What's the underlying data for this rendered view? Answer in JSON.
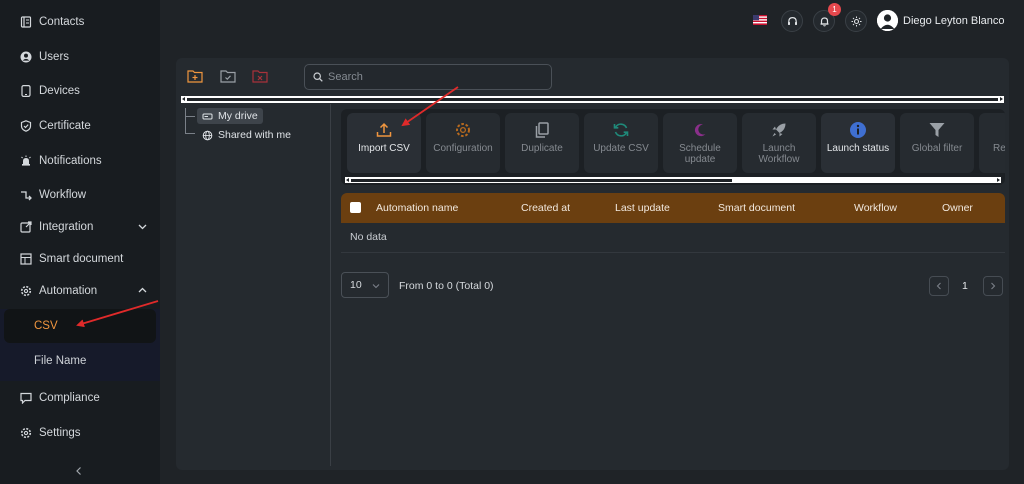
{
  "sidebar": {
    "items": [
      {
        "label": "Contacts",
        "icon": "contacts-icon"
      },
      {
        "label": "Users",
        "icon": "user-icon"
      },
      {
        "label": "Devices",
        "icon": "device-icon"
      },
      {
        "label": "Certificate",
        "icon": "shield-check-icon"
      },
      {
        "label": "Notifications",
        "icon": "alarm-icon"
      },
      {
        "label": "Workflow",
        "icon": "workflow-icon"
      },
      {
        "label": "Integration",
        "icon": "external-link-icon"
      },
      {
        "label": "Smart document",
        "icon": "table-icon"
      },
      {
        "label": "Automation",
        "icon": "gear-icon"
      },
      {
        "label": "Compliance",
        "icon": "chat-icon"
      },
      {
        "label": "Settings",
        "icon": "settings-icon"
      }
    ],
    "automation_children": [
      {
        "label": "CSV",
        "active": true
      },
      {
        "label": "File Name",
        "active": false
      }
    ]
  },
  "header": {
    "notification_count": "1",
    "user_name": "Diego Leyton Blanco"
  },
  "search": {
    "placeholder": "Search"
  },
  "tree": {
    "nodes": [
      {
        "label": "My drive",
        "selected": true
      },
      {
        "label": "Shared with me",
        "selected": false
      }
    ]
  },
  "actions": [
    {
      "label": "Import CSV",
      "icon": "upload-icon",
      "color": "#f0963f",
      "enabled": true
    },
    {
      "label": "Configuration",
      "icon": "gear-icon",
      "color": "#b86a1e",
      "enabled": false
    },
    {
      "label": "Duplicate",
      "icon": "copy-icon",
      "color": "#9aa0a6",
      "enabled": false
    },
    {
      "label": "Update CSV",
      "icon": "refresh-icon",
      "color": "#1f8a7a",
      "enabled": false
    },
    {
      "label": "Schedule update",
      "icon": "moon-icon",
      "color": "#8a2f8a",
      "enabled": false
    },
    {
      "label": "Launch Workflow",
      "icon": "rocket-icon",
      "color": "#9aa0a6",
      "enabled": false
    },
    {
      "label": "Launch status",
      "icon": "info-icon",
      "color": "#3f6fd1",
      "enabled": true
    },
    {
      "label": "Global filter",
      "icon": "filter-icon",
      "color": "#9aa0a6",
      "enabled": false
    },
    {
      "label": "Re",
      "icon": "",
      "color": "#9aa0a6",
      "enabled": false
    }
  ],
  "table": {
    "columns": [
      "Automation name",
      "Created at",
      "Last update",
      "Smart document",
      "Workflow",
      "Owner"
    ],
    "empty_text": "No data",
    "header_color": "#6b3f10"
  },
  "pagination": {
    "page_size": "10",
    "info": "From 0 to 0 (Total 0)",
    "current_page": "1"
  },
  "colors": {
    "accent": "#f0963f",
    "annotation_arrow": "#e02a2a"
  }
}
